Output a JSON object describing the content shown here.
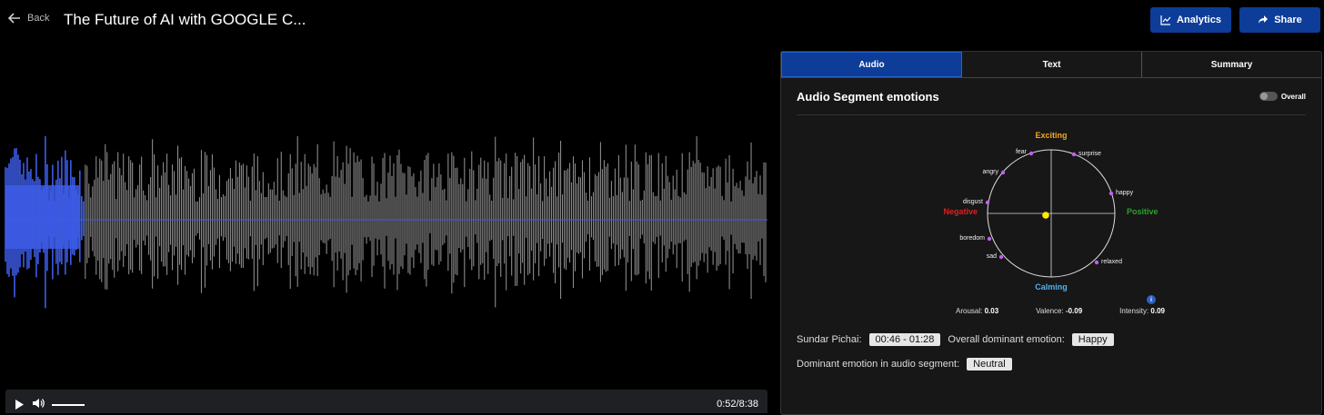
{
  "header": {
    "back_label": "Back",
    "title": "The Future of AI with GOOGLE C...",
    "analytics_label": "Analytics",
    "share_label": "Share",
    "accent_color": "#0d3d99"
  },
  "player": {
    "progress_fraction": 0.104,
    "time": "0:52/8:38"
  },
  "panel": {
    "tabs": [
      {
        "label": "Audio",
        "active": true
      },
      {
        "label": "Text",
        "active": false
      },
      {
        "label": "Summary",
        "active": false
      }
    ],
    "section_title": "Audio Segment emotions",
    "toggle_label": "Overall",
    "circumplex": {
      "top_label": "Exciting",
      "bottom_label": "Calming",
      "left_label": "Negative",
      "right_label": "Positive",
      "emotions": [
        "fear",
        "surprise",
        "angry",
        "happy",
        "disgust",
        "boredom",
        "sad",
        "relaxed"
      ]
    },
    "metrics": {
      "arousal_label": "Arousal:",
      "arousal_value": "0.03",
      "valence_label": "Valence:",
      "valence_value": "-0.09",
      "intensity_label": "Intensity:",
      "intensity_value": "0.09"
    },
    "speaker": {
      "name_label": "Sundar Pichai:",
      "range": "00:46 - 01:28",
      "overall_label": "Overall dominant emotion:",
      "overall_value": "Happy",
      "segment_label": "Dominant emotion in audio segment:",
      "segment_value": "Neutral"
    }
  }
}
